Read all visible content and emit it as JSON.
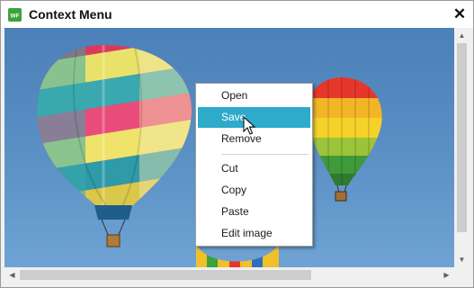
{
  "window": {
    "title": "Context Menu",
    "app_icon_text": "WF",
    "close_glyph": "✕"
  },
  "scrollbars": {
    "up_glyph": "▲",
    "down_glyph": "▼",
    "left_glyph": "◀",
    "right_glyph": "▶"
  },
  "context_menu": {
    "items": [
      {
        "label": "Open"
      },
      {
        "label": "Save",
        "state": "hovered"
      },
      {
        "label": "Remove"
      },
      {
        "label": "Cut"
      },
      {
        "label": "Copy"
      },
      {
        "label": "Paste"
      },
      {
        "label": "Edit image"
      }
    ]
  },
  "colors": {
    "menu_highlight": "#2eaacb",
    "app_icon": "#3aa23a",
    "sky": "#5a8fc4"
  },
  "icons": {
    "app": "winforms-app-icon",
    "close": "close-icon",
    "cursor": "mouse-pointer-icon"
  }
}
